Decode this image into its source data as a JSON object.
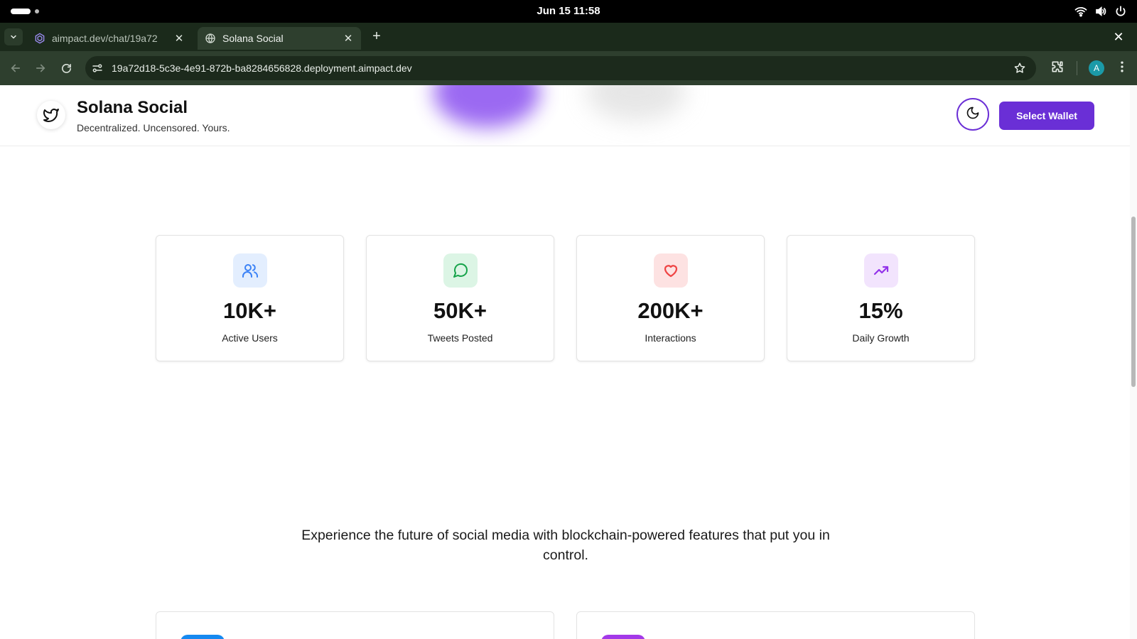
{
  "os": {
    "clock": "Jun 15  11:58"
  },
  "browser": {
    "tabs": [
      {
        "title": "aimpact.dev/chat/19a72"
      },
      {
        "title": "Solana Social"
      }
    ],
    "new_tab": "+",
    "close_window": "✕",
    "url": "19a72d18-5c3e-4e91-872b-ba8284656828.deployment.aimpact.dev",
    "profile_initial": "A"
  },
  "header": {
    "title": "Solana Social",
    "tagline": "Decentralized. Uncensored. Yours.",
    "wallet_button": "Select Wallet"
  },
  "stats": [
    {
      "value": "10K+",
      "label": "Active Users",
      "icon": "users-icon",
      "icon_color": "#3b82f6",
      "bg": "#e3eefe"
    },
    {
      "value": "50K+",
      "label": "Tweets Posted",
      "icon": "message-circle-icon",
      "icon_color": "#16a34a",
      "bg": "#dcf5e5"
    },
    {
      "value": "200K+",
      "label": "Interactions",
      "icon": "heart-icon",
      "icon_color": "#ef4444",
      "bg": "#fde2e2"
    },
    {
      "value": "15%",
      "label": "Daily Growth",
      "icon": "trending-up-icon",
      "icon_color": "#9333ea",
      "bg": "#f2e4fd"
    }
  ],
  "lead_text": "Experience the future of social media with blockchain-powered features that put you in control.",
  "colors": {
    "accent": "#6a2fd6",
    "feature_blue": "#1689f0",
    "feature_purple": "#a339e8"
  }
}
